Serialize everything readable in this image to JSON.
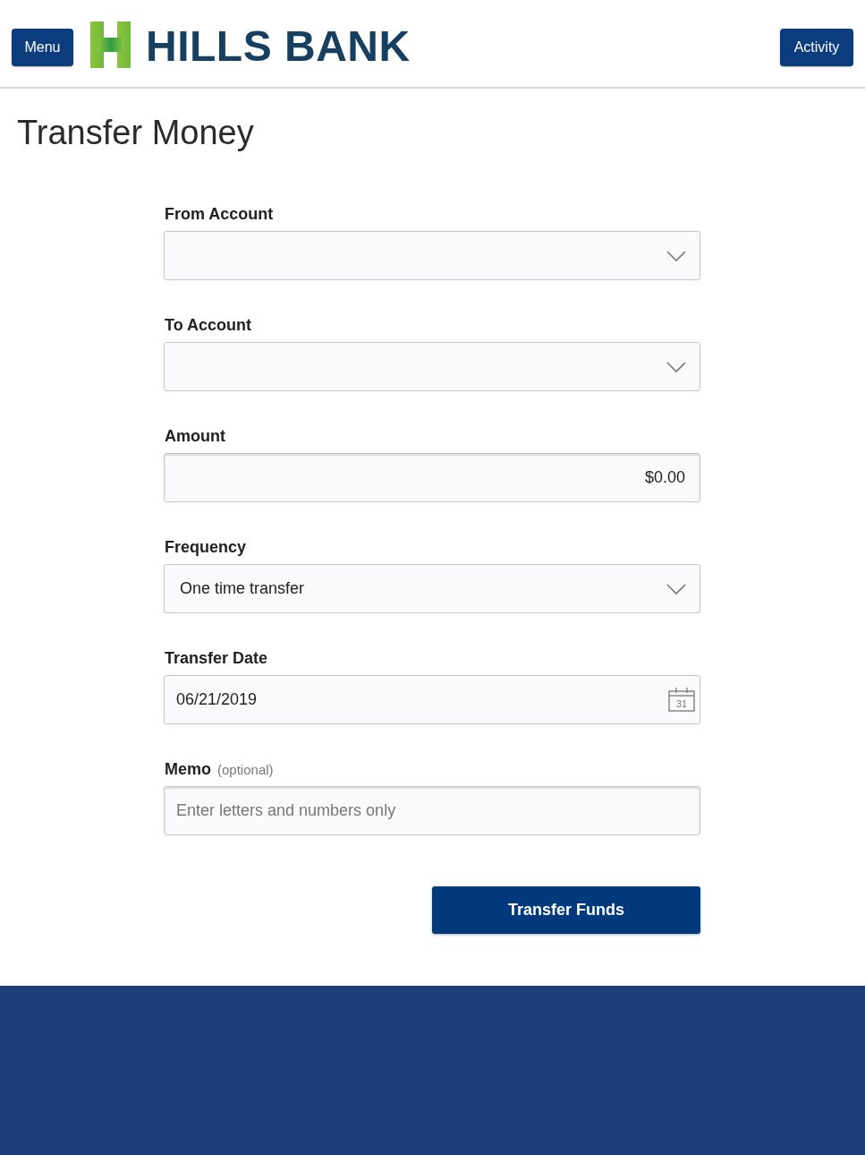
{
  "header": {
    "menu_button": "Menu",
    "logo_text": "HILLS BANK",
    "activity_button": "Activity"
  },
  "page_title": "Transfer Money",
  "form": {
    "fields": [
      {
        "kind": "select",
        "label": "From Account"
      },
      {
        "kind": "select",
        "label": "To Account"
      },
      {
        "kind": "amount",
        "label": "Amount",
        "value": "$0.00"
      },
      {
        "kind": "select",
        "label": "Frequency",
        "value": "One time transfer"
      },
      {
        "kind": "date",
        "label": "Transfer Date",
        "value": "06/21/2019",
        "icon_text": "31"
      },
      {
        "kind": "text",
        "label": "Memo",
        "hint": "(optional)",
        "placeholder": "Enter letters and numbers only"
      }
    ],
    "submit_button": "Transfer Funds"
  }
}
